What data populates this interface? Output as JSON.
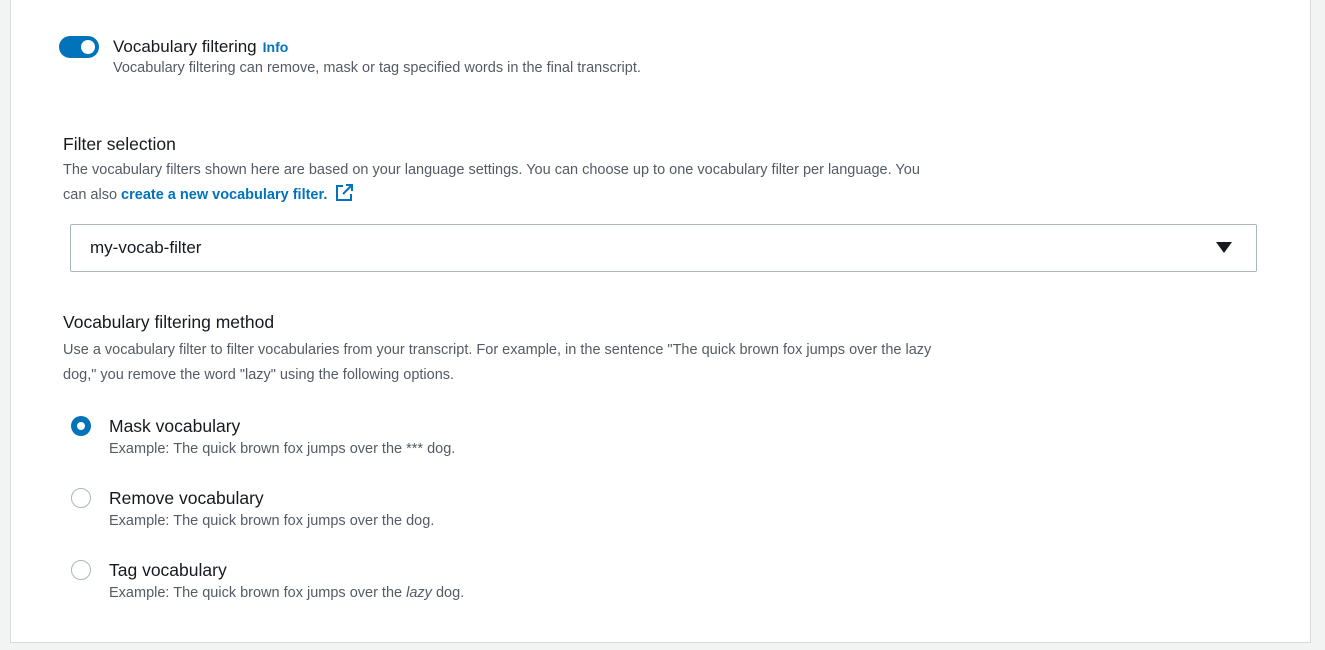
{
  "vocab_filtering": {
    "toggle_on": true,
    "title": "Vocabulary filtering",
    "info_label": "Info",
    "description": "Vocabulary filtering can remove, mask or tag specified words in the final transcript."
  },
  "filter_selection": {
    "label": "Filter selection",
    "description_part1": "The vocabulary filters shown here are based on your language settings. You can choose up to one vocabulary filter per language. You",
    "description_part2": "can also ",
    "link_text": "create a new vocabulary filter.",
    "selected_value": "my-vocab-filter"
  },
  "filtering_method": {
    "label": "Vocabulary filtering method",
    "description_line1": "Use a vocabulary filter to filter vocabularies from your transcript. For example, in the sentence \"The quick brown fox jumps over the lazy",
    "description_line2": "dog,\" you remove the word \"lazy\" using the following options.",
    "options": [
      {
        "label": "Mask vocabulary",
        "example": "Example: The quick brown fox jumps over the *** dog.",
        "checked": true
      },
      {
        "label": "Remove vocabulary",
        "example": "Example: The quick brown fox jumps over the dog.",
        "checked": false
      },
      {
        "label": "Tag vocabulary",
        "example_before": "Example: The quick brown fox jumps over the ",
        "example_em": "lazy",
        "example_after": " dog.",
        "checked": false
      }
    ]
  },
  "colors": {
    "accent": "#0073bb",
    "text": "#16191f",
    "muted": "#545b64",
    "border": "#aab7b8"
  }
}
